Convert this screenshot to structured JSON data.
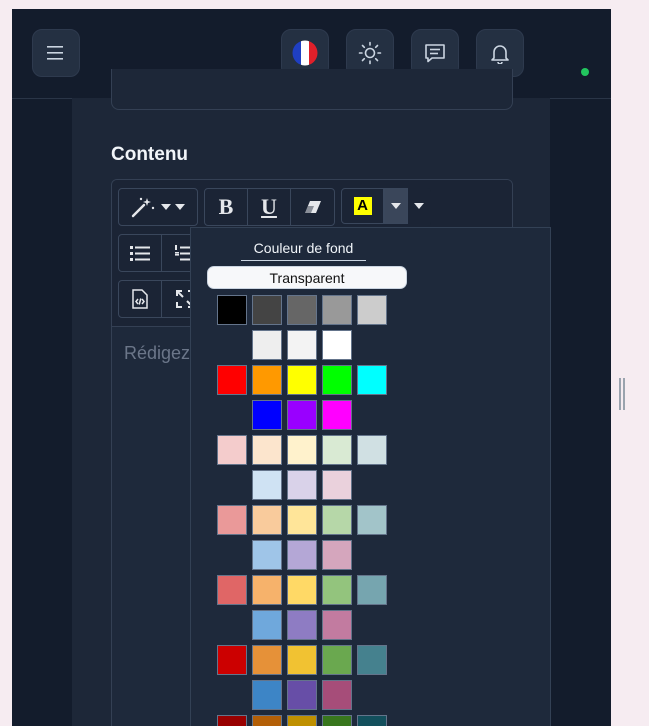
{
  "header": {
    "menu_icon": "hamburger-icon",
    "flag_icon": "france-flag-icon",
    "theme_icon": "sun-icon",
    "messages_icon": "chat-icon",
    "notifications_icon": "bell-icon",
    "status_color": "#22c55e"
  },
  "form": {
    "section_title": "Contenu",
    "editor_placeholder": "Rédigez"
  },
  "toolbar": {
    "groups": [
      [
        "magic-wand-icon",
        "caret-down-icon"
      ],
      [
        "bold-icon",
        "underline-icon",
        "eraser-icon"
      ],
      [
        "highlight-A-icon",
        "caret-down-icon",
        "caret-down-icon"
      ],
      [
        "bullet-list-icon",
        "ordered-list-icon"
      ],
      [
        "code-view-icon",
        "fullscreen-icon"
      ]
    ],
    "highlight_color": "#ffff00"
  },
  "color_dropdown": {
    "title": "Couleur de fond",
    "transparent_label": "Transparent",
    "rows": [
      [
        "#000000",
        "#444444",
        "#666666",
        "#999999",
        "#cccccc"
      ],
      [
        "#eeeeee",
        "#f3f3f3",
        "#ffffff"
      ],
      [
        "#ff0000",
        "#ff9900",
        "#ffff00",
        "#00ff00",
        "#00ffff"
      ],
      [
        "#0000ff",
        "#9900ff",
        "#ff00ff"
      ],
      [
        "#f4cccc",
        "#fce5cd",
        "#fff2cc",
        "#d9ead3",
        "#d0e0e3"
      ],
      [
        "#cfe2f3",
        "#d9d2e9",
        "#ead1dc"
      ],
      [
        "#ea9999",
        "#f9cb9c",
        "#ffe599",
        "#b6d7a8",
        "#a2c4c9"
      ],
      [
        "#9fc5e8",
        "#b4a7d6",
        "#d5a6bd"
      ],
      [
        "#e06666",
        "#f6b26b",
        "#ffd966",
        "#93c47d",
        "#76a5af"
      ],
      [
        "#6fa8dc",
        "#8e7cc3",
        "#c27ba0"
      ],
      [
        "#cc0000",
        "#e69138",
        "#f1c232",
        "#6aa84f",
        "#45818e"
      ],
      [
        "#3d85c6",
        "#674ea7",
        "#a64d79"
      ],
      [
        "#990000",
        "#b45f06",
        "#bf9000",
        "#38761d",
        "#134f5c"
      ]
    ]
  }
}
